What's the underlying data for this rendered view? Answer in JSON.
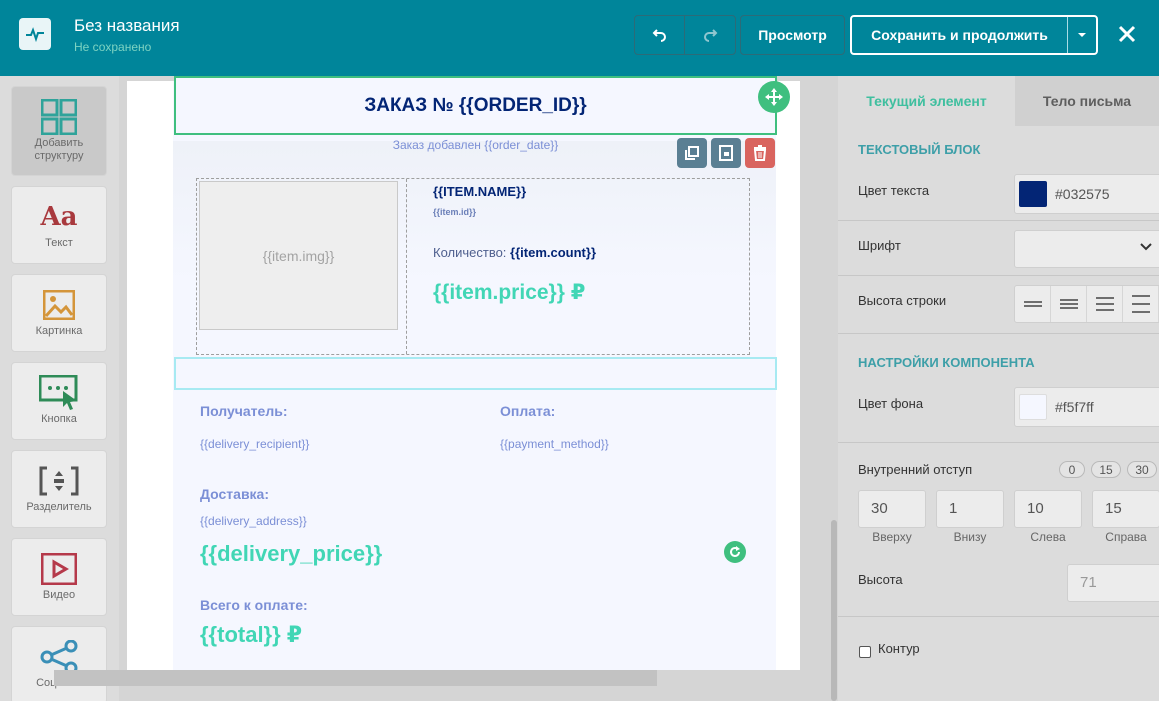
{
  "header": {
    "title": "Без названия",
    "status": "Не сохранено",
    "preview_label": "Просмотр",
    "save_label": "Сохранить и продолжить"
  },
  "sidebar": {
    "items": [
      {
        "label": "Добавить\nструктуру",
        "icon": "grid-icon"
      },
      {
        "label": "Текст",
        "icon": "text-icon"
      },
      {
        "label": "Картинка",
        "icon": "image-icon"
      },
      {
        "label": "Кнопка",
        "icon": "button-icon"
      },
      {
        "label": "Разделитель",
        "icon": "divider-icon"
      },
      {
        "label": "Видео",
        "icon": "video-icon"
      },
      {
        "label": "Соц.сети",
        "icon": "share-icon"
      }
    ]
  },
  "canvas": {
    "title": "ЗАКАЗ № {{ORDER_ID}}",
    "subtitle": "Заказ добавлен {{order_date}}",
    "item": {
      "img_placeholder": "{{item.img}}",
      "name": "{{ITEM.NAME}}",
      "id": "{{item.id}}",
      "count_label": "Количество: ",
      "count_value": "{{item.count}}",
      "price": "{{item.price}} ₽"
    },
    "recipient_label": "Получатель:",
    "recipient_value": "{{delivery_recipient}}",
    "payment_label": "Оплата:",
    "payment_value": "{{payment_method}}",
    "delivery_label": "Доставка:",
    "delivery_address": "{{delivery_address}}",
    "delivery_price": "{{delivery_price}}",
    "total_label": "Всего к оплате:",
    "total_value": "{{total}} ₽"
  },
  "panel": {
    "tab_current": "Текущий элемент",
    "tab_body": "Тело письма",
    "section_text_block": "ТЕКСТОВЫЙ БЛОК",
    "text_color_label": "Цвет текста",
    "text_color_value": "#032575",
    "font_label": "Шрифт",
    "line_height_label": "Высота строки",
    "section_component": "НАСТРОЙКИ КОМПОНЕНТА",
    "bg_color_label": "Цвет фона",
    "bg_color_value": "#f5f7ff",
    "padding_label": "Внутренний отступ",
    "padding_presets": [
      "0",
      "15",
      "30"
    ],
    "padding": {
      "top": {
        "value": "30",
        "label": "Вверху"
      },
      "bottom": {
        "value": "1",
        "label": "Внизу"
      },
      "left": {
        "value": "10",
        "label": "Слева"
      },
      "right": {
        "value": "15",
        "label": "Справа"
      }
    },
    "height_label": "Высота",
    "height_placeholder": "71",
    "outline_label": "Контур"
  },
  "colors": {
    "brand": "#00859a",
    "accent_green": "#3fbf7f",
    "price_teal": "#41d6b5",
    "text_navy": "#032575",
    "danger": "#d9645f"
  }
}
